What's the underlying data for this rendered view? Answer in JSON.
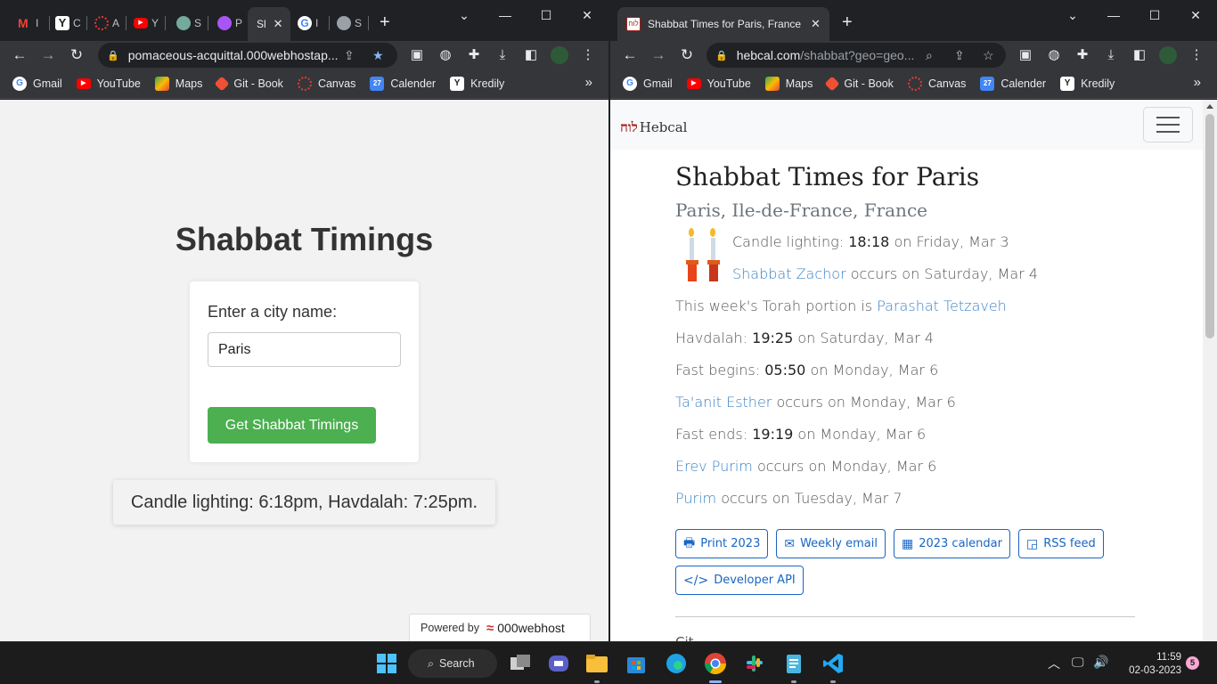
{
  "left_browser": {
    "tabs": [
      {
        "initial": "I"
      },
      {
        "initial": "C"
      },
      {
        "initial": "A"
      },
      {
        "initial": "Y"
      },
      {
        "initial": "S"
      },
      {
        "initial": "P"
      }
    ],
    "active_tab": {
      "initial": "Sl"
    },
    "tabs_after": [
      {
        "initial": "I"
      },
      {
        "initial": "S"
      }
    ],
    "url": "pomaceous-acquittal.000webhostap...",
    "bookmarks": [
      "Gmail",
      "YouTube",
      "Maps",
      "Git - Book",
      "Canvas",
      "Calender",
      "Kredily"
    ],
    "page": {
      "title": "Shabbat Timings",
      "label": "Enter a city name:",
      "input_value": "Paris",
      "button": "Get Shabbat Timings",
      "result": "Candle lighting: 6:18pm, Havdalah: 7:25pm.",
      "powered_by": "Powered by",
      "powered_brand": "000webhost"
    }
  },
  "right_browser": {
    "tab_title": "Shabbat Times for Paris, France -",
    "url_host": "hebcal.com",
    "url_path": "/shabbat?geo=geo...",
    "bookmarks": [
      "Gmail",
      "YouTube",
      "Maps",
      "Git - Book",
      "Canvas",
      "Calender",
      "Kredily"
    ],
    "page": {
      "logo_hebrew": "לוח",
      "logo_text": "Hebcal",
      "h1": "Shabbat Times for Paris",
      "h2": "Paris, Ile-de-France, France",
      "candle": {
        "label": "Candle lighting:",
        "time": "18:18",
        "rest": "on Friday, Mar 3"
      },
      "zachor": {
        "link": "Shabbat Zachor",
        "rest": "occurs on Saturday, Mar 4"
      },
      "torah": {
        "label": "This week's Torah portion is",
        "link": "Parashat Tetzaveh"
      },
      "havdalah": {
        "label": "Havdalah:",
        "time": "19:25",
        "rest": "on Saturday, Mar 4"
      },
      "fast_begins": {
        "label": "Fast begins:",
        "time": "05:50",
        "rest": "on Monday, Mar 6"
      },
      "taanit": {
        "link": "Ta'anit Esther",
        "rest": "occurs on Monday, Mar 6"
      },
      "fast_ends": {
        "label": "Fast ends:",
        "time": "19:19",
        "rest": "on Monday, Mar 6"
      },
      "erev_purim": {
        "link": "Erev Purim",
        "rest": "occurs on Monday, Mar 6"
      },
      "purim": {
        "link": "Purim",
        "rest": "occurs on Tuesday, Mar 7"
      },
      "buttons": {
        "print": "Print 2023",
        "email": "Weekly email",
        "calendar": "2023 calendar",
        "rss": "RSS feed",
        "api": "Developer API"
      },
      "cut_text": "Cit"
    }
  },
  "taskbar": {
    "search": "Search",
    "time": "11:59",
    "date": "02-03-2023",
    "notifications": "5"
  },
  "colors": {
    "accent_green": "#4caf50",
    "hebcal_link": "#3b82c4",
    "hebcal_button": "#1866c4"
  }
}
